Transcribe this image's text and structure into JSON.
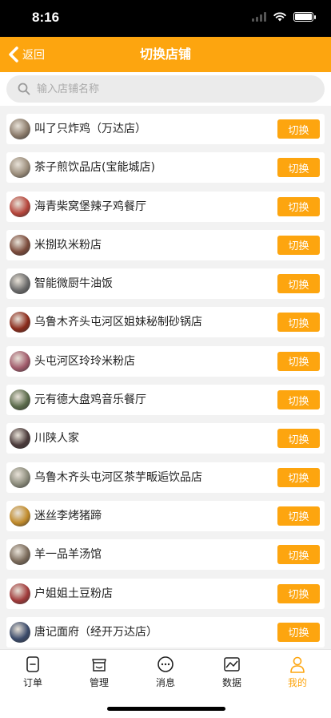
{
  "status": {
    "time": "8:16"
  },
  "nav": {
    "back_label": "返回",
    "title": "切换店铺"
  },
  "search": {
    "placeholder": "输入店铺名称"
  },
  "stores": [
    {
      "name": "叫了只炸鸡（万达店）",
      "button": "切换",
      "avatar_color": "#8a7a6a"
    },
    {
      "name": "茶子煎饮品店(宝能城店)",
      "button": "切换",
      "avatar_color": "#9a8c7a"
    },
    {
      "name": "海青柴窝堡辣子鸡餐厅",
      "button": "切换",
      "avatar_color": "#b5443a"
    },
    {
      "name": "米捌玖米粉店",
      "button": "切换",
      "avatar_color": "#7a4a3a"
    },
    {
      "name": "智能微厨牛油饭",
      "button": "切换",
      "avatar_color": "#6a6a6a"
    },
    {
      "name": "乌鲁木齐头屯河区姐妹秘制砂锅店",
      "button": "切换",
      "avatar_color": "#8a2a1a"
    },
    {
      "name": "头屯河区玲玲米粉店",
      "button": "切换",
      "avatar_color": "#a05a6a"
    },
    {
      "name": "元有德大盘鸡音乐餐厅",
      "button": "切换",
      "avatar_color": "#5a6a4a"
    },
    {
      "name": "川陕人家",
      "button": "切换",
      "avatar_color": "#4a3a3a"
    },
    {
      "name": "乌鲁木齐头屯河区茶芋畈逅饮品店",
      "button": "切换",
      "avatar_color": "#8a8a7a"
    },
    {
      "name": "迷丝李烤猪蹄",
      "button": "切换",
      "avatar_color": "#c08a2a"
    },
    {
      "name": "羊一品羊汤馆",
      "button": "切换",
      "avatar_color": "#7a6a5a"
    },
    {
      "name": "户姐姐土豆粉店",
      "button": "切换",
      "avatar_color": "#a03a3a"
    },
    {
      "name": "唐记面府（经开万达店）",
      "button": "切换",
      "avatar_color": "#3a4a6a"
    }
  ],
  "tabbar": [
    {
      "label": "订单",
      "icon": "order-icon",
      "active": false
    },
    {
      "label": "管理",
      "icon": "store-icon",
      "active": false
    },
    {
      "label": "消息",
      "icon": "message-icon",
      "active": false
    },
    {
      "label": "数据",
      "icon": "chart-icon",
      "active": false
    },
    {
      "label": "我的",
      "icon": "user-icon",
      "active": true
    }
  ],
  "colors": {
    "accent": "#fda50f"
  }
}
